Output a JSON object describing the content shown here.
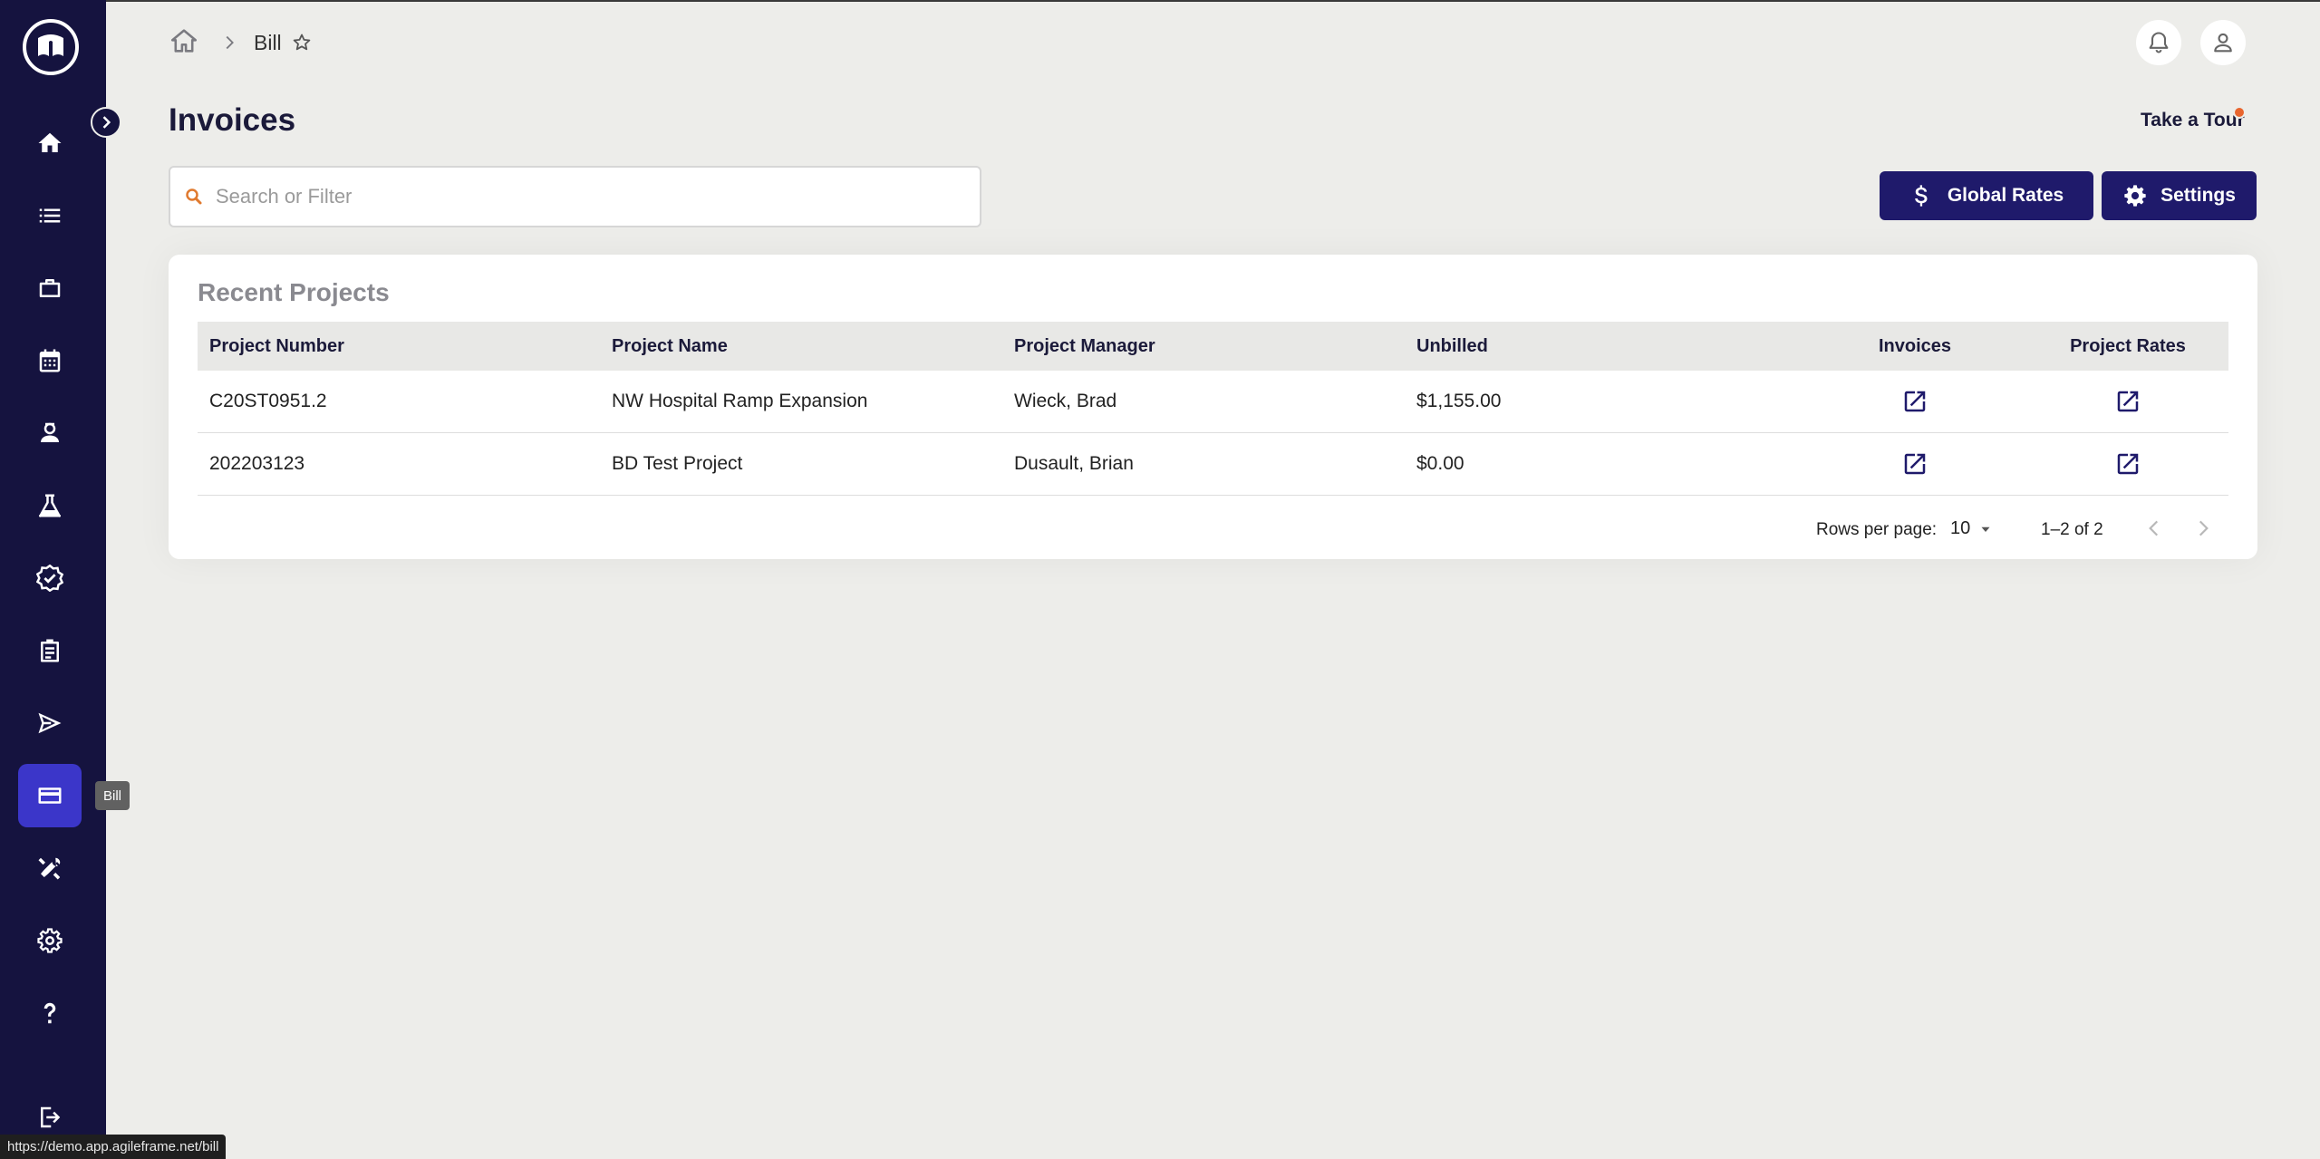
{
  "breadcrumb": {
    "current": "Bill"
  },
  "page": {
    "title": "Invoices",
    "tour_label": "Take a Tour"
  },
  "search": {
    "placeholder": "Search or Filter",
    "value": ""
  },
  "buttons": {
    "global_rates": "Global Rates",
    "settings": "Settings"
  },
  "sidebar": {
    "tooltip": "Bill",
    "items": [
      {
        "icon": "home-icon"
      },
      {
        "icon": "list-icon"
      },
      {
        "icon": "briefcase-icon"
      },
      {
        "icon": "calendar-icon"
      },
      {
        "icon": "user-badge-icon"
      },
      {
        "icon": "flask-icon"
      },
      {
        "icon": "verified-icon"
      },
      {
        "icon": "clipboard-icon"
      },
      {
        "icon": "send-icon"
      },
      {
        "icon": "credit-card-icon",
        "active": true
      },
      {
        "icon": "tools-icon"
      },
      {
        "icon": "gear-icon"
      },
      {
        "icon": "help-icon"
      },
      {
        "icon": "logout-icon"
      }
    ]
  },
  "status_bar": {
    "url": "https://demo.app.agileframe.net/bill"
  },
  "recent_projects": {
    "title": "Recent Projects",
    "columns": [
      "Project Number",
      "Project Name",
      "Project Manager",
      "Unbilled",
      "Invoices",
      "Project Rates"
    ],
    "rows": [
      {
        "number": "C20ST0951.2",
        "name": "NW Hospital Ramp Expansion",
        "manager": "Wieck, Brad",
        "unbilled": "$1,155.00"
      },
      {
        "number": "202203123",
        "name": "BD Test Project",
        "manager": "Dusault, Brian",
        "unbilled": "$0.00"
      }
    ],
    "pagination": {
      "rows_per_page_label": "Rows per page:",
      "rows_per_page": "10",
      "range": "1–2 of 2"
    }
  },
  "colors": {
    "sidebar": "#15133f",
    "active": "#3b36c9",
    "button": "#1f1a6b",
    "accent": "#e8652e",
    "background": "#ededea"
  }
}
